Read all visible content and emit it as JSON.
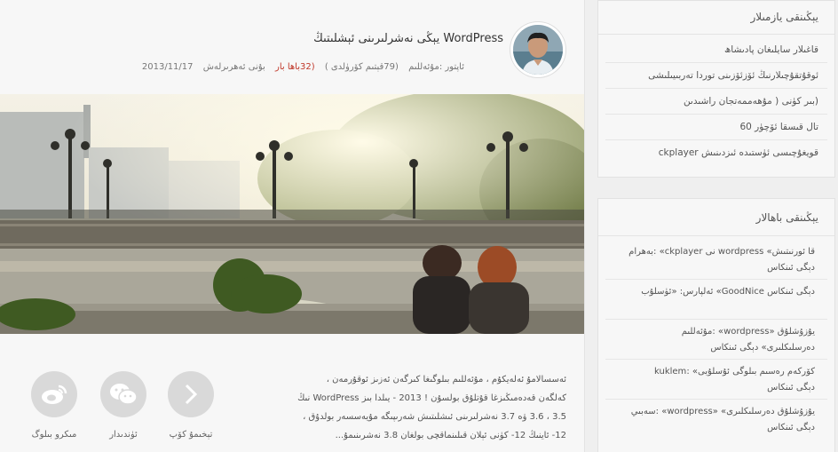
{
  "post": {
    "title": "WordPress يېڭى نەشرلىرىنى ئېشلىتىڭ",
    "meta": {
      "date": "2013/11/17",
      "views_label": "بۇنى ئەھرىرلەش",
      "comments": "(32باھا بار",
      "reads": "(79قېتىم كۆرۈلدى )",
      "author": "ئاپتور :مۇئەللىم"
    },
    "excerpt": [
      "ئەسسالامۇ ئەلەيكۇم ، مۇئەللىم بىلوگىغا كىرگەن ئەزىز ئوقۇرمەن ،",
      "كەلگەن قەدەمىڭىزغا قۇتلۇق بولسۇن ! 2013 - يىلدا بىز WordPress نىڭ",
      "3.5 ، 3.6 ۋە 3.7 نەشرلىرىنى ئىشلىتىش شەرىپىگە مۇيەسسەر بولدۇق ،",
      "12- ئاينىڭ 12- كۈنى ئېلان قىلىنماقچى بولغان 3.8 نەشرىنىمۇ..."
    ],
    "share": [
      {
        "label": "تېخىمۇ كۆپ",
        "icon": "chevron-right-icon"
      },
      {
        "label": "ئۈندىدار",
        "icon": "wechat-icon"
      },
      {
        "label": "مىكرو بىلوگ",
        "icon": "weibo-icon"
      }
    ]
  },
  "sidebar": {
    "recent": {
      "title": "يېڭىنقى يازمىلار",
      "items": [
        "قاغىلار سايلىغان پادىشاھ",
        "ئوقۇتقۇچىلارنىڭ ئۆزئۆزىنى توردا تەربىيىلىشى",
        "(بىر كۈنى ( مۇھەممەتجان راشىدىن",
        "تال قىسقا ئۆچۈر 60",
        "قويغۇچىسى ئۈستىدە ئىزدىنىش ckplayer"
      ]
    },
    "comments": {
      "title": "يېڭىنقى باھالار",
      "items": [
        {
          "line1": "قا ئورنىتىش» wordpress نى ckplayer» :بەھرام",
          "line2": "دېگى ئىنكاس"
        },
        {
          "line1": "دېگى ئىنكاس GoodNice» ئەلپارس: «ئۈسلۇب",
          "line2": ""
        },
        {
          "line1": "يۇزۇشلۇق «wordpress» :مۇئەللىم",
          "line2": "دەرسلىكلىرى» دېگى ئىنكاس"
        },
        {
          "line1": "كۆركەم رەسىم بىلوگى ئۇسلۇبى» :kuklem",
          "line2": "دېگى ئىنكاس"
        },
        {
          "line1": "يۇزۇشلۇق دەرسلىكلىرى» «wordpress» :سەبىي",
          "line2": "دېگى ئىنكاس"
        }
      ]
    }
  }
}
